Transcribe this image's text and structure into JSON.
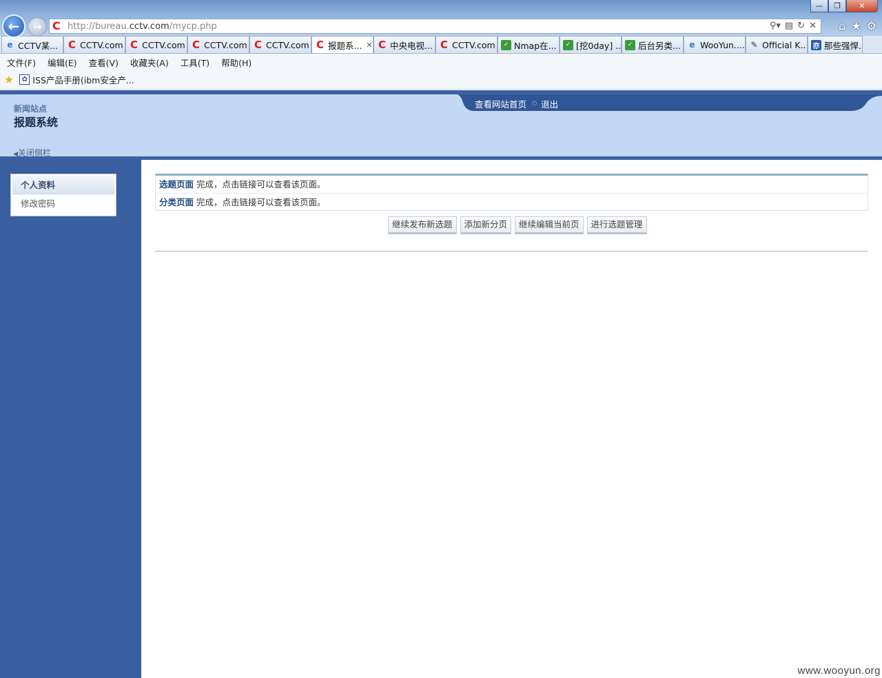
{
  "browser": {
    "url_prefix": "http://bureau.",
    "url_domain": "cctv.com",
    "url_path": "/mycp.php",
    "tabs": [
      {
        "label": "CCTV某...",
        "icon": "ie",
        "active": false
      },
      {
        "label": "CCTV.com",
        "icon": "cctv",
        "active": false
      },
      {
        "label": "CCTV.com",
        "icon": "cctv",
        "active": false
      },
      {
        "label": "CCTV.com",
        "icon": "cctv",
        "active": false
      },
      {
        "label": "CCTV.com",
        "icon": "cctv",
        "active": false
      },
      {
        "label": "报题系...",
        "icon": "cctv",
        "active": true
      },
      {
        "label": "中央电视...",
        "icon": "cctv",
        "active": false
      },
      {
        "label": "CCTV.com",
        "icon": "cctv",
        "active": false
      },
      {
        "label": "Nmap在...",
        "icon": "shield",
        "active": false
      },
      {
        "label": "[挖0day] ...",
        "icon": "shield",
        "active": false
      },
      {
        "label": "后台另类...",
        "icon": "shield",
        "active": false
      },
      {
        "label": "WooYun....",
        "icon": "ie",
        "active": false
      },
      {
        "label": "Official K...",
        "icon": "knife",
        "active": false
      },
      {
        "label": "那些强悍...",
        "icon": "yi",
        "active": false
      }
    ],
    "menu": [
      "文件(F)",
      "编辑(E)",
      "查看(V)",
      "收藏夹(A)",
      "工具(T)",
      "帮助(H)"
    ],
    "favorite": "ISS产品手册(ibm安全产..."
  },
  "header": {
    "site_small": "新闻站点",
    "site_title": "报题系统",
    "close_sidebar": "关闭侧栏",
    "nav_home": "查看网站首页",
    "nav_logout": "退出"
  },
  "sidebar": {
    "items": [
      {
        "label": "个人资料"
      },
      {
        "label": "修改密码"
      }
    ]
  },
  "main": {
    "messages": [
      {
        "link": "选题页面",
        "text": " 完成，点击链接可以查看该页面。"
      },
      {
        "link": "分类页面",
        "text": " 完成，点击链接可以查看该页面。"
      }
    ],
    "buttons": [
      "继续发布新选题",
      "添加新分页",
      "继续编辑当前页",
      "进行选题管理"
    ]
  },
  "watermark": "www.wooyun.org",
  "colors": {
    "header_bg": "#c3d8f5",
    "sidebar_bg": "#3a5fa0",
    "nav_bar": "#2f5696"
  }
}
